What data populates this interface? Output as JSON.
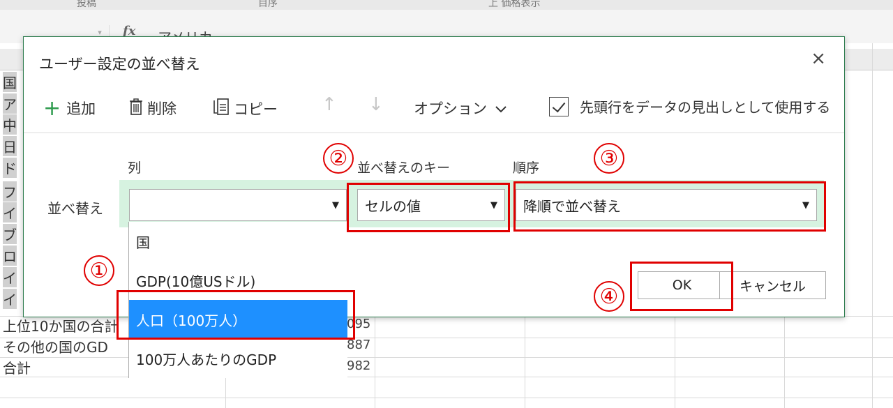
{
  "spreadsheet": {
    "header_fragments": [
      "投稿",
      "目序",
      "上 価格表示"
    ],
    "formula_bar": {
      "fx": "fx",
      "value": "アメリカ"
    },
    "visible_rows": [
      {
        "label": "国"
      },
      {
        "label": "ア"
      },
      {
        "label": "中"
      },
      {
        "label": "日"
      },
      {
        "label": "ド"
      },
      {
        "label": "フ"
      },
      {
        "label": "イ"
      },
      {
        "label": "ブ"
      },
      {
        "label": "ロ"
      },
      {
        "label": "イ"
      },
      {
        "label": "イ"
      },
      {
        "label": "上位10か国の合計",
        "value": "095"
      },
      {
        "label": "その他の国のGD",
        "value": "887"
      },
      {
        "label": "合計",
        "value": "982"
      }
    ]
  },
  "dialog": {
    "title": "ユーザー設定の並べ替え",
    "close": "×",
    "toolbar": {
      "add": "追加",
      "delete": "削除",
      "copy": "コピー",
      "up": "↑",
      "down": "↓",
      "options": "オプション",
      "header_checkbox_label": "先頭行をデータの見出しとして使用する"
    },
    "columns": {
      "column": "列",
      "sort_key": "並べ替えのキー",
      "order": "順序"
    },
    "row": {
      "label": "並べ替え",
      "column_value": "",
      "sort_key_value": "セルの値",
      "order_value": "降順で並べ替え"
    },
    "dropdown_options": [
      "国",
      "GDP(10億USドル)",
      "人口（100万人）",
      "100万人あたりのGDP"
    ],
    "dropdown_selected_index": 2,
    "ok": "OK",
    "cancel": "キャンセル"
  },
  "annotations": [
    "①",
    "②",
    "③",
    "④"
  ],
  "colors": {
    "accent_green": "#2e9b4d",
    "annotation_red": "#e00000",
    "selection_blue": "#1e90ff",
    "highlight_green": "#d6f2e0"
  }
}
